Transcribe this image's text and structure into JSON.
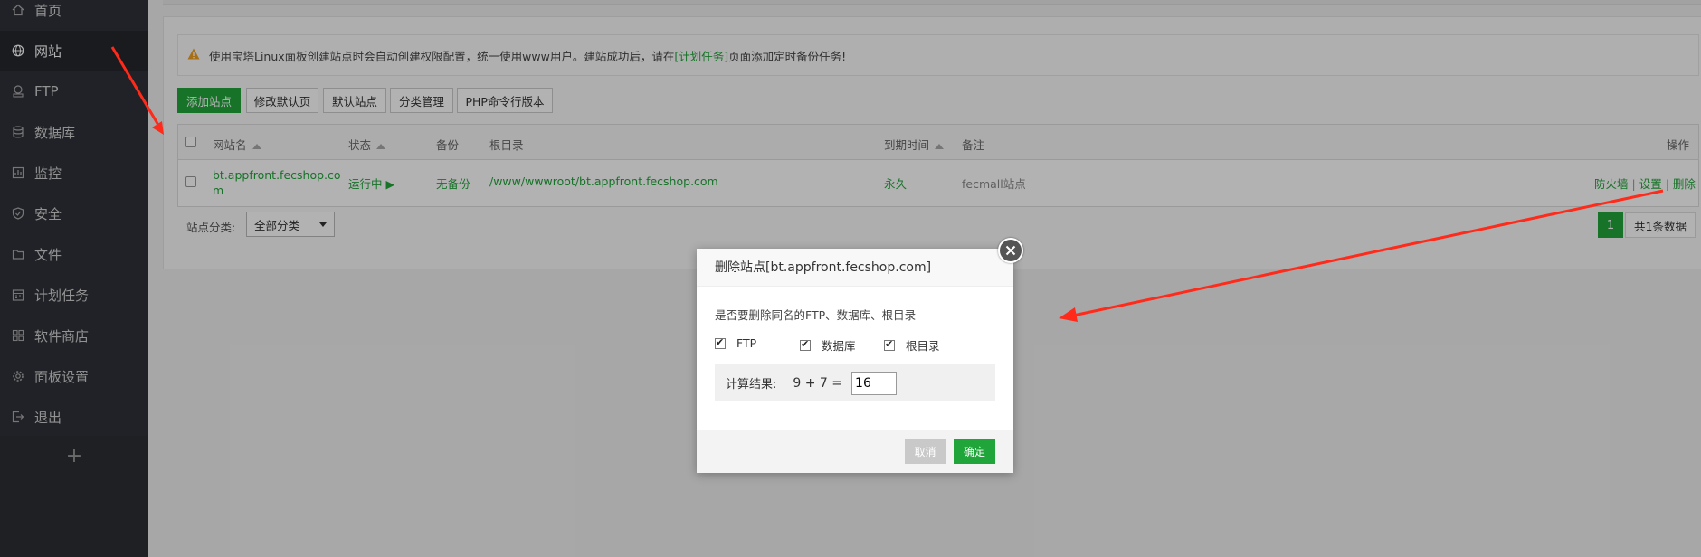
{
  "sidebar": {
    "items": [
      {
        "label": "首页",
        "icon": "home-icon"
      },
      {
        "label": "网站",
        "icon": "globe-icon"
      },
      {
        "label": "FTP",
        "icon": "ftp-icon"
      },
      {
        "label": "数据库",
        "icon": "database-icon"
      },
      {
        "label": "监控",
        "icon": "monitor-icon"
      },
      {
        "label": "安全",
        "icon": "shield-icon"
      },
      {
        "label": "文件",
        "icon": "folder-icon"
      },
      {
        "label": "计划任务",
        "icon": "calendar-icon"
      },
      {
        "label": "软件商店",
        "icon": "apps-icon"
      },
      {
        "label": "面板设置",
        "icon": "gear-icon"
      },
      {
        "label": "退出",
        "icon": "logout-icon"
      }
    ],
    "add_symbol": "+"
  },
  "notice": {
    "prefix": "使用宝塔Linux面板创建站点时会自动创建权限配置，统一使用www用户。建站成功后，请在",
    "link": "[计划任务]",
    "suffix": "页面添加定时备份任务!"
  },
  "toolbar": {
    "add_site": "添加站点",
    "edit_default_page": "修改默认页",
    "default_site": "默认站点",
    "category_manage": "分类管理",
    "php_cli_version": "PHP命令行版本"
  },
  "table": {
    "headers": {
      "name": "网站名",
      "status": "状态",
      "backup": "备份",
      "root": "根目录",
      "expire": "到期时间",
      "note": "备注",
      "actions": "操作"
    },
    "rows": [
      {
        "name_line1": "bt.appfront.fecshop.co",
        "name_line2": "m",
        "status": "运行中 ▶",
        "backup": "无备份",
        "root": "/www/wwwroot/bt.appfront.fecshop.com",
        "expire": "永久",
        "note": "fecmall站点",
        "action_firewall": "防火墙",
        "action_settings": "设置",
        "action_delete": "删除",
        "separator": "|"
      }
    ]
  },
  "filter": {
    "label": "站点分类:",
    "selected": "全部分类"
  },
  "pager": {
    "current": "1",
    "total": "共1条数据"
  },
  "dialog": {
    "title": "删除站点[bt.appfront.fecshop.com]",
    "question": "是否要删除同名的FTP、数据库、根目录",
    "options": {
      "ftp": "FTP",
      "database": "数据库",
      "root": "根目录"
    },
    "calc_label": "计算结果:",
    "calc_expr": "9 + 7  =",
    "calc_value": "16",
    "cancel": "取消",
    "confirm": "确定"
  },
  "colors": {
    "accent": "#20a53a",
    "arrow": "#ff2a1a"
  }
}
